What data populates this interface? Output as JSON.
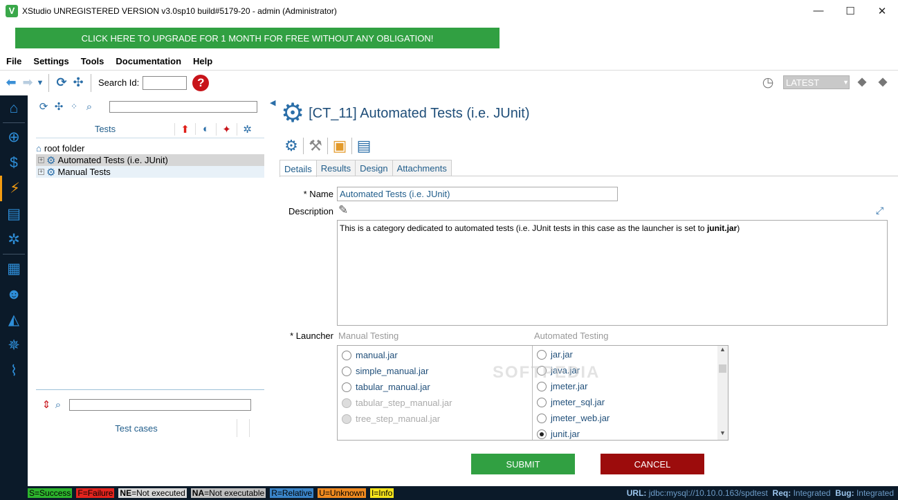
{
  "window": {
    "title": "XStudio UNREGISTERED VERSION v3.0sp10 build#5179-20 - admin (Administrator)",
    "logo_letter": "V",
    "controls": [
      "—",
      "☐",
      "✕"
    ]
  },
  "upgrade_banner": "CLICK HERE TO UPGRADE FOR 1 MONTH FOR FREE WITHOUT ANY OBLIGATION!",
  "menu": [
    "File",
    "Settings",
    "Tools",
    "Documentation",
    "Help"
  ],
  "toolbar": {
    "search_label": "Search Id:",
    "search_value": "",
    "help_glyph": "?",
    "version_select": "LATEST"
  },
  "left_panel": {
    "tests_header": "Tests",
    "tree": [
      {
        "label": "root folder",
        "type": "root"
      },
      {
        "label": "Automated Tests (i.e. JUnit)",
        "type": "category",
        "selected": true
      },
      {
        "label": "Manual Tests",
        "type": "category",
        "selected": false
      }
    ],
    "testcases_header": "Test cases"
  },
  "content": {
    "title": "[CT_11] Automated Tests (i.e. JUnit)",
    "tabs": [
      "Details",
      "Results",
      "Design",
      "Attachments"
    ],
    "active_tab": "Details",
    "name_label": "* Name",
    "name_value": "Automated Tests (i.e. JUnit)",
    "description_label": "Description",
    "description_text": "This is a category dedicated to automated tests (i.e. JUnit tests in this case as the launcher is set to ",
    "description_bold": "junit.jar",
    "description_end": ")",
    "launcher_label": "* Launcher",
    "manual_header": "Manual Testing",
    "automated_header": "Automated Testing",
    "manual_launchers": [
      {
        "label": "manual.jar",
        "enabled": true
      },
      {
        "label": "simple_manual.jar",
        "enabled": true
      },
      {
        "label": "tabular_manual.jar",
        "enabled": true
      },
      {
        "label": "tabular_step_manual.jar",
        "enabled": false
      },
      {
        "label": "tree_step_manual.jar",
        "enabled": false
      }
    ],
    "automated_launchers": [
      {
        "label": "jar.jar",
        "checked": false
      },
      {
        "label": "java.jar",
        "checked": false
      },
      {
        "label": "jmeter.jar",
        "checked": false
      },
      {
        "label": "jmeter_sql.jar",
        "checked": false
      },
      {
        "label": "jmeter_web.jar",
        "checked": false
      },
      {
        "label": "junit.jar",
        "checked": true
      }
    ],
    "submit_label": "SUBMIT",
    "cancel_label": "CANCEL",
    "watermark": "SOFTPEDIA"
  },
  "status": {
    "legend": [
      {
        "key": "S",
        "text": "S=Success"
      },
      {
        "key": "F",
        "text": "F=Failure"
      },
      {
        "key": "NE",
        "text": "=Not executed"
      },
      {
        "key": "NA",
        "text": "=Not executable"
      },
      {
        "key": "R",
        "text": "R=Relative"
      },
      {
        "key": "U",
        "text": "U=Unknown"
      },
      {
        "key": "I",
        "text": "I=Info"
      }
    ],
    "url_label": "URL:",
    "url_value": "jdbc:mysql://10.10.0.163/spdtest",
    "req_label": "Req:",
    "req_value": "Integrated",
    "bug_label": "Bug:",
    "bug_value": "Integrated"
  }
}
